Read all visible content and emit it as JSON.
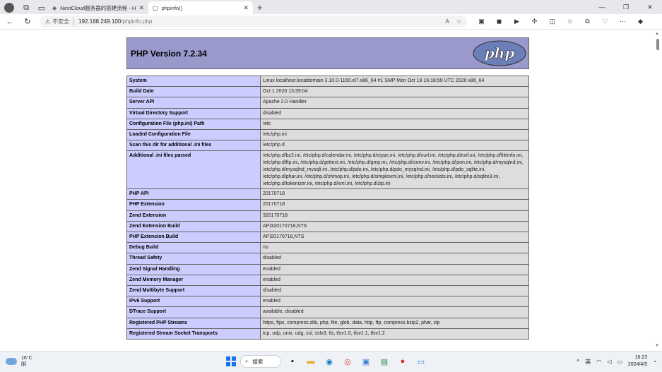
{
  "browser": {
    "tabs": [
      {
        "title": "NextCloud服务器的搭建流程 - H",
        "active": false
      },
      {
        "title": "phpinfo()",
        "active": true
      }
    ],
    "new_tab": "+",
    "security_label": "不安全",
    "url_host": "192.168.249.100",
    "url_path": "/phpinfo.php",
    "window_controls": [
      "—",
      "❐",
      "✕"
    ]
  },
  "php": {
    "title": "PHP Version 7.2.34",
    "logo_text": "php"
  },
  "info_rows": [
    {
      "key": "System",
      "value": "Linux localhost.localdomain 3.10.0-1160.el7.x86_64 #1 SMP Mon Oct 19 16:18:59 UTC 2020 x86_64"
    },
    {
      "key": "Build Date",
      "value": "Oct 1 2020 13:39:04"
    },
    {
      "key": "Server API",
      "value": "Apache 2.0 Handler"
    },
    {
      "key": "Virtual Directory Support",
      "value": "disabled"
    },
    {
      "key": "Configuration File (php.ini) Path",
      "value": "/etc"
    },
    {
      "key": "Loaded Configuration File",
      "value": "/etc/php.ini"
    },
    {
      "key": "Scan this dir for additional .ini files",
      "value": "/etc/php.d"
    },
    {
      "key": "Additional .ini files parsed",
      "value": "/etc/php.d/bz2.ini, /etc/php.d/calendar.ini, /etc/php.d/ctype.ini, /etc/php.d/curl.ini, /etc/php.d/exif.ini, /etc/php.d/fileinfo.ini, /etc/php.d/ftp.ini, /etc/php.d/gettext.ini, /etc/php.d/gmp.ini, /etc/php.d/iconv.ini, /etc/php.d/json.ini, /etc/php.d/mysqlnd.ini, /etc/php.d/mysqlnd_mysqli.ini, /etc/php.d/pdo.ini, /etc/php.d/pdo_mysqlnd.ini, /etc/php.d/pdo_sqlite.ini, /etc/php.d/phar.ini, /etc/php.d/shmop.ini, /etc/php.d/simplexml.ini, /etc/php.d/sockets.ini, /etc/php.d/sqlite3.ini, /etc/php.d/tokenizer.ini, /etc/php.d/xml.ini, /etc/php.d/zip.ini"
    },
    {
      "key": "PHP API",
      "value": "20170718"
    },
    {
      "key": "PHP Extension",
      "value": "20170718"
    },
    {
      "key": "Zend Extension",
      "value": "320170718"
    },
    {
      "key": "Zend Extension Build",
      "value": "API320170718,NTS"
    },
    {
      "key": "PHP Extension Build",
      "value": "API20170718,NTS"
    },
    {
      "key": "Debug Build",
      "value": "no"
    },
    {
      "key": "Thread Safety",
      "value": "disabled"
    },
    {
      "key": "Zend Signal Handling",
      "value": "enabled"
    },
    {
      "key": "Zend Memory Manager",
      "value": "enabled"
    },
    {
      "key": "Zend Multibyte Support",
      "value": "disabled"
    },
    {
      "key": "IPv6 Support",
      "value": "enabled"
    },
    {
      "key": "DTrace Support",
      "value": "available, disabled"
    },
    {
      "key": "Registered PHP Streams",
      "value": "https, ftps, compress.zlib, php, file, glob, data, http, ftp, compress.bzip2, phar, zip"
    },
    {
      "key": "Registered Stream Socket Transports",
      "value": "tcp, udp, unix, udg, ssl, sslv3, tls, tlsv1.0, tlsv1.1, tlsv1.2"
    }
  ],
  "taskbar": {
    "weather_temp": "16°C",
    "weather_desc": "阴",
    "search_label": "搜索",
    "input_lang": "英",
    "time": "16:23",
    "date": "2024/4/5"
  },
  "colors": {
    "php_header": "#9999cc",
    "key_cell": "#ccccff",
    "value_cell": "#dddddd"
  }
}
